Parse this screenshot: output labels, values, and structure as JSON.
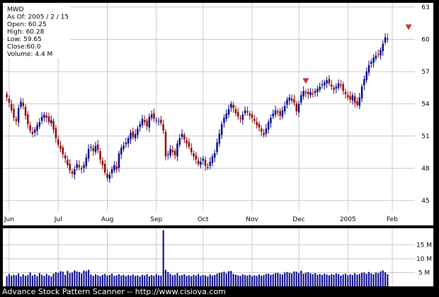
{
  "chart_data": {
    "type": "candlestick",
    "ticker": "MWD",
    "info": {
      "as_of": "As Of: 2005 / 2 / 15",
      "open": "Open: 60.25",
      "high": "High: 60.28",
      "low": "Low: 59.65",
      "close": "Close:60.0",
      "volume": "Volume: 4.4 M"
    },
    "price_ticks": [
      "63",
      "60",
      "57",
      "54",
      "51",
      "48",
      "45"
    ],
    "price_tick_values": [
      63,
      60,
      57,
      54,
      51,
      48,
      45
    ],
    "ylim": [
      44,
      63.4
    ],
    "volume_ticks": [
      "15 M",
      "10 M",
      "5 M"
    ],
    "volume_tick_values": [
      15,
      10,
      5
    ],
    "volume_ylim": [
      0,
      21
    ],
    "month_labels": [
      "Jun",
      "Jul",
      "Aug",
      "Sep",
      "Oct",
      "Nov",
      "Dec",
      "2005",
      "Feb"
    ],
    "month_label_positions": [
      1,
      22,
      43,
      64,
      84,
      105,
      125,
      146,
      165
    ],
    "n_sessions": 174,
    "closes": [
      54.6,
      54.1,
      53.4,
      52.7,
      52.4,
      53.6,
      54.2,
      53.8,
      52.9,
      52.1,
      51.5,
      51.2,
      51.6,
      52.0,
      52.3,
      52.8,
      53.0,
      52.7,
      52.3,
      52.5,
      51.6,
      50.8,
      50.2,
      49.8,
      49.3,
      48.9,
      48.3,
      47.8,
      47.5,
      47.9,
      48.4,
      48.1,
      47.9,
      48.3,
      49.0,
      49.8,
      50.0,
      49.6,
      50.1,
      49.7,
      48.8,
      48.3,
      47.6,
      47.1,
      47.4,
      47.9,
      48.3,
      47.9,
      49.4,
      49.9,
      50.1,
      50.4,
      50.8,
      51.3,
      50.9,
      51.2,
      51.7,
      52.1,
      52.6,
      52.3,
      51.9,
      52.8,
      53.0,
      52.6,
      52.5,
      52.4,
      52.2,
      51.5,
      49.1,
      49.3,
      49.8,
      49.5,
      49.2,
      50.3,
      50.8,
      51.2,
      50.7,
      50.3,
      50.0,
      49.5,
      49.1,
      48.8,
      48.4,
      48.6,
      48.9,
      48.2,
      48.1,
      48.6,
      49.1,
      49.4,
      50.4,
      51.2,
      52.1,
      52.7,
      53.1,
      53.5,
      54.0,
      53.6,
      53.1,
      52.8,
      52.6,
      53.0,
      53.4,
      53.2,
      52.9,
      52.7,
      52.4,
      52.0,
      51.8,
      51.4,
      51.1,
      51.7,
      52.3,
      52.7,
      53.1,
      53.4,
      53.2,
      52.9,
      53.4,
      53.8,
      54.4,
      54.6,
      54.3,
      54.1,
      53.3,
      54.0,
      54.8,
      55.2,
      55.0,
      54.9,
      55.1,
      54.9,
      55.2,
      55.4,
      55.6,
      55.8,
      56.0,
      56.2,
      55.9,
      55.6,
      55.3,
      55.6,
      55.9,
      55.7,
      55.2,
      54.9,
      54.6,
      54.4,
      54.8,
      54.1,
      53.9,
      54.6,
      55.6,
      56.3,
      57.0,
      57.6,
      57.9,
      58.3,
      58.5,
      58.6,
      59.0,
      59.6,
      60.2,
      60.0
    ],
    "volumes": [
      3.7,
      4.5,
      3.9,
      4.2,
      4.0,
      4.7,
      3.6,
      4.4,
      3.8,
      4.1,
      5.0,
      3.9,
      4.3,
      3.7,
      4.8,
      4.2,
      3.8,
      4.5,
      4.0,
      3.6,
      4.6,
      5.1,
      4.9,
      5.5,
      5.3,
      4.2,
      5.6,
      4.8,
      5.0,
      5.8,
      5.4,
      5.2,
      4.7,
      5.7,
      5.5,
      6.0,
      4.3,
      3.8,
      4.4,
      4.0,
      3.7,
      4.2,
      4.5,
      3.9,
      4.1,
      4.6,
      3.8,
      4.0,
      4.4,
      3.9,
      4.2,
      3.7,
      4.1,
      3.9,
      4.3,
      3.8,
      4.0,
      3.6,
      4.2,
      3.9,
      4.4,
      3.7,
      4.1,
      3.8,
      4.5,
      4.0,
      3.9,
      20.3,
      6.0,
      5.2,
      4.5,
      4.0,
      4.2,
      4.8,
      3.9,
      4.1,
      4.4,
      3.8,
      4.0,
      3.7,
      4.2,
      3.9,
      4.5,
      3.8,
      4.1,
      4.0,
      3.6,
      4.3,
      3.9,
      4.1,
      4.6,
      4.9,
      5.0,
      5.3,
      4.7,
      5.5,
      5.6,
      4.5,
      4.2,
      4.0,
      3.8,
      4.4,
      4.1,
      3.9,
      4.2,
      3.7,
      4.0,
      3.8,
      4.3,
      3.9,
      4.1,
      4.5,
      4.6,
      4.2,
      4.4,
      4.8,
      4.9,
      4.5,
      4.3,
      5.0,
      5.2,
      4.9,
      4.7,
      5.4,
      5.3,
      4.8,
      5.7,
      4.6,
      4.9,
      5.1,
      4.7,
      4.4,
      4.8,
      4.2,
      4.5,
      4.1,
      4.6,
      4.3,
      4.0,
      4.4,
      4.2,
      4.7,
      4.5,
      3.9,
      4.3,
      4.6,
      4.0,
      4.4,
      4.1,
      4.8,
      4.2,
      4.5,
      4.9,
      5.0,
      4.6,
      5.2,
      4.7,
      4.4,
      5.0,
      4.8,
      5.4,
      5.8,
      5.1,
      4.4
    ],
    "markers": [
      {
        "type": "triangle-down",
        "session": 128,
        "value": 56.1
      },
      {
        "type": "triangle-down",
        "session": 172,
        "value": 61.1
      }
    ]
  },
  "footer": "Advance Stock Pattern Scanner -- http://www.cisiova.com",
  "colors": {
    "background": "#000000",
    "panel": "#ffffff",
    "grid": "#c8c8c8",
    "up": "#00008b",
    "down": "#8b0000",
    "volume": "#00008b",
    "marker": "#e8302a",
    "axis_text": "#000000"
  }
}
